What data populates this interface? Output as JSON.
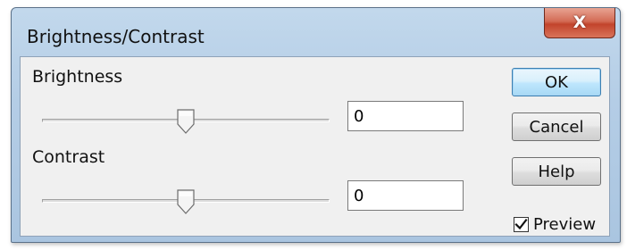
{
  "window": {
    "title": "Brightness/Contrast",
    "close_label": "X"
  },
  "brightness": {
    "label": "Brightness",
    "value": "0",
    "slider_position": 0.5
  },
  "contrast": {
    "label": "Contrast",
    "value": "0",
    "slider_position": 0.5
  },
  "buttons": {
    "ok": "OK",
    "cancel": "Cancel",
    "help": "Help"
  },
  "preview": {
    "label": "Preview",
    "checked": true
  },
  "icons": {
    "close": "close-icon",
    "slider_thumb": "slider-thumb-icon",
    "checkmark": "checkmark-icon"
  },
  "colors": {
    "title_bar": "#b4cde6",
    "close_button": "#c2442c",
    "client_bg": "#f0f0f0",
    "default_button_border": "#3c7fb1"
  }
}
